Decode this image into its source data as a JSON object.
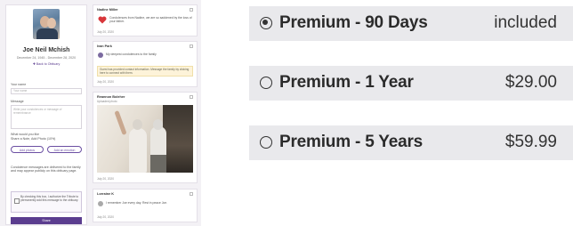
{
  "memorial": {
    "sidebar": {
      "name": "Joe Neil Mchish",
      "dates": "December 24, 1945 - December 28, 2020",
      "link": "✚ Back to Obituary",
      "name_label": "Your name",
      "name_placeholder": "Your name",
      "message_label": "Message",
      "message_placeholder": "Write your condolences or message of remembrance",
      "prompt_line1": "What would you like",
      "prompt_line2": "Share a Note, Add Photo (10%)",
      "btn_add_photo": "Add photos",
      "btn_add_video": "Add an emotion",
      "note_text": "Condolence messages are delivered to the family and may appear publicly on this obituary page.",
      "checkbox_text": "By checking this box, I authorize the Tribute to permanently add this message to the obituary.",
      "share_label": "Share"
    },
    "posts": [
      {
        "header": "Nadine Miller",
        "text": "Condolences from Nadine, we are so saddened by the loss of your father.",
        "date": "July 20, 2020"
      },
      {
        "header": "Ivan Park",
        "text": "My deepest condolences to the family",
        "note": "Guest has provided contact information. Message the family by clicking here to connect with them.",
        "date": "July 20, 2020"
      },
      {
        "header": "Reannon Boleher",
        "subheader": "Uploaded photo",
        "date": "July 20, 2020"
      },
      {
        "header": "Lorraine K",
        "text": "I remember Joe every day. Rest in peace Joe.",
        "date": "July 20, 2020"
      }
    ]
  },
  "options": [
    {
      "label": "Premium - 90 Days",
      "price": "included",
      "selected": true
    },
    {
      "label": "Premium - 1 Year",
      "price": "$29.00",
      "selected": false
    },
    {
      "label": "Premium - 5 Years",
      "price": "$59.99",
      "selected": false
    }
  ],
  "colors": {
    "accent": "#5b3d8f",
    "panel_bg": "#e9e9ec",
    "text": "#2b2b2b"
  }
}
